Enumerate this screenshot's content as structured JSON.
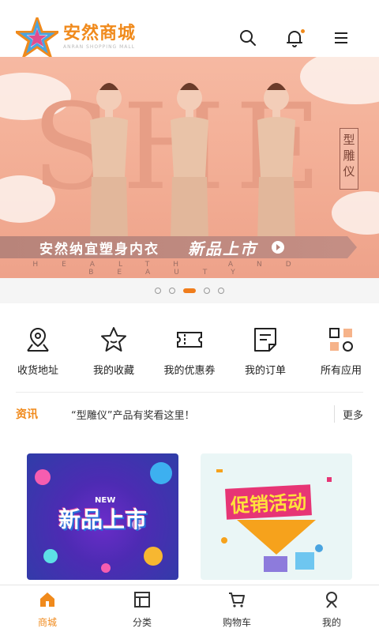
{
  "header": {
    "logo_text": "安然商城",
    "logo_sub": "ANRAN SHOPPING MALL",
    "accent_color": "#f08a1c",
    "icons": [
      "search-icon",
      "bell-icon",
      "menu-icon"
    ]
  },
  "banner": {
    "watermark": "SHE",
    "vertical_tag": "型雕仪",
    "bar_left": "安然纳宜塑身内衣",
    "bar_right": "新品上市",
    "sub": "HEALTH AND BEAUTY",
    "slide_index": 3,
    "slide_count": 5
  },
  "shortcuts": [
    {
      "label": "收货地址",
      "icon": "location-pin-icon"
    },
    {
      "label": "我的收藏",
      "icon": "star-icon"
    },
    {
      "label": "我的优惠券",
      "icon": "coupon-icon"
    },
    {
      "label": "我的订单",
      "icon": "order-icon"
    },
    {
      "label": "所有应用",
      "icon": "apps-icon"
    }
  ],
  "news": {
    "tag": "资讯",
    "text": "“型雕仪”产品有奖看这里！",
    "more": "更多"
  },
  "promos": [
    {
      "title": "新品上市",
      "badge": "NEW"
    },
    {
      "title": "促销活动"
    }
  ],
  "tabbar": {
    "items": [
      {
        "label": "商城",
        "icon": "home-icon",
        "active": true
      },
      {
        "label": "分类",
        "icon": "category-icon",
        "active": false
      },
      {
        "label": "购物车",
        "icon": "cart-icon",
        "active": false
      },
      {
        "label": "我的",
        "icon": "user-icon",
        "active": false
      }
    ]
  }
}
